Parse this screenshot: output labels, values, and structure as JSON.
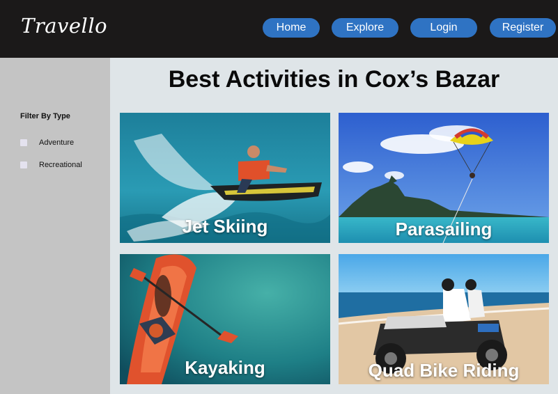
{
  "header": {
    "logo": "Travello",
    "nav": [
      {
        "label": "Home"
      },
      {
        "label": "Explore"
      },
      {
        "label": "Login"
      },
      {
        "label": "Register"
      }
    ]
  },
  "sidebar": {
    "filter_title": "Filter By Type",
    "filters": [
      {
        "label": "Adventure",
        "checked": false
      },
      {
        "label": "Recreational",
        "checked": false
      }
    ]
  },
  "main": {
    "title": "Best Activities in Cox’s Bazar",
    "activities": [
      {
        "label": "Jet Skiing",
        "image": "jet-ski-photo"
      },
      {
        "label": "Parasailing",
        "image": "parasailing-photo"
      },
      {
        "label": "Kayaking",
        "image": "kayaking-photo"
      },
      {
        "label": "Quad Bike Riding",
        "image": "quad-bike-photo"
      }
    ]
  },
  "colors": {
    "topbar": "#1b1919",
    "nav_button": "#2f73c3",
    "sidebar": "#c4c4c4",
    "main_bg": "#dfe5e8"
  }
}
